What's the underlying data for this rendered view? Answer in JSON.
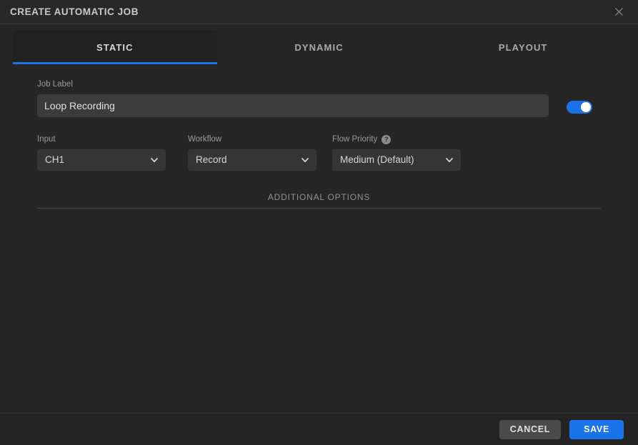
{
  "header": {
    "title": "CREATE AUTOMATIC JOB",
    "close_icon": "close-icon"
  },
  "tabs": [
    {
      "label": "STATIC",
      "active": true
    },
    {
      "label": "DYNAMIC",
      "active": false
    },
    {
      "label": "PLAYOUT",
      "active": false
    }
  ],
  "form": {
    "job_label": {
      "label": "Job Label",
      "value": "Loop Recording",
      "placeholder": "Job Label"
    },
    "enabled_toggle": {
      "state": "on"
    },
    "input": {
      "label": "Input",
      "value": "CH1"
    },
    "workflow": {
      "label": "Workflow",
      "value": "Record"
    },
    "flow_priority": {
      "label": "Flow Priority",
      "value": "Medium (Default)",
      "help_icon_glyph": "?"
    },
    "additional_options": {
      "label": "ADDITIONAL OPTIONS"
    }
  },
  "footer": {
    "cancel_label": "CANCEL",
    "save_label": "SAVE"
  },
  "colors": {
    "accent": "#1a73e8",
    "background": "#262626",
    "header_background": "#282828",
    "field_background": "#3b3b3b",
    "select_background": "#353535",
    "cancel_button": "#4a4a4a",
    "text_primary": "#d8d8d8",
    "text_muted": "#9a9a9a"
  }
}
